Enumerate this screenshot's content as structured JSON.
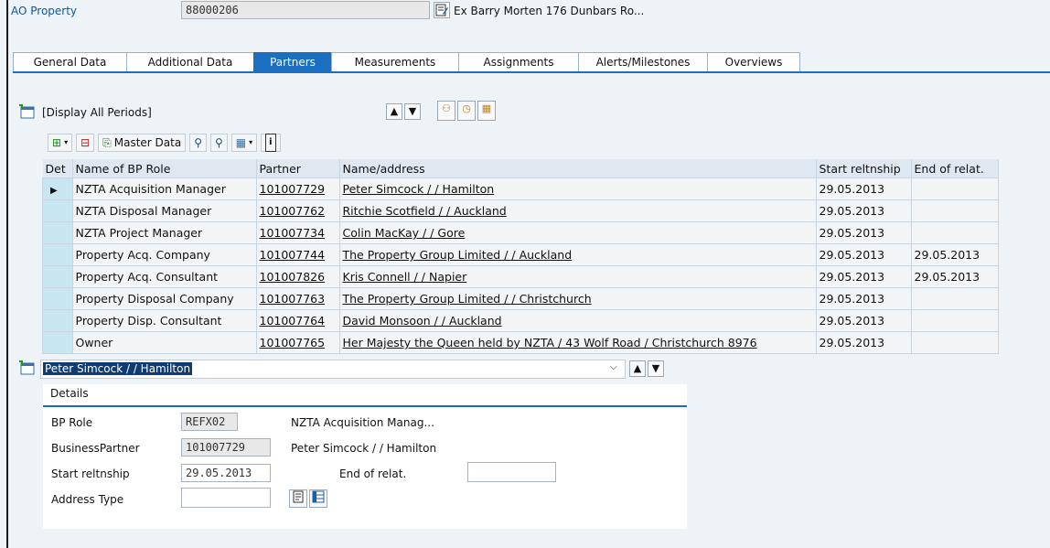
{
  "header": {
    "object_label": "AO Property",
    "object_id": "88000206",
    "object_desc": "Ex Barry Morten 176 Dunbars Ro..."
  },
  "tabs": [
    {
      "label": "General Data",
      "active": false
    },
    {
      "label": "Additional Data",
      "active": false
    },
    {
      "label": "Partners",
      "active": true
    },
    {
      "label": "Measurements",
      "active": false
    },
    {
      "label": "Assignments",
      "active": false
    },
    {
      "label": "Alerts/Milestones",
      "active": false
    },
    {
      "label": "Overviews",
      "active": false
    }
  ],
  "period_select": {
    "value": "[Display All Periods]"
  },
  "toolbar": {
    "master_data": "Master Data"
  },
  "table": {
    "columns": [
      "Det",
      "Name of BP Role",
      "Partner",
      "Name/address",
      "Start reltnship",
      "End of relat."
    ],
    "rows": [
      {
        "role": "NZTA Acquisition Manager",
        "partner": "101007729",
        "name": "Peter Simcock / / Hamilton",
        "start": "29.05.2013",
        "end": "",
        "selected": true
      },
      {
        "role": "NZTA Disposal Manager",
        "partner": "101007762",
        "name": "Ritchie Scotfield / / Auckland",
        "start": "29.05.2013",
        "end": ""
      },
      {
        "role": "NZTA Project Manager",
        "partner": "101007734",
        "name": "Colin MacKay / / Gore",
        "start": "29.05.2013",
        "end": ""
      },
      {
        "role": "Property Acq. Company",
        "partner": "101007744",
        "name": "The Property Group Limited / / Auckland",
        "start": "29.05.2013",
        "end": "29.05.2013"
      },
      {
        "role": "Property Acq. Consultant",
        "partner": "101007826",
        "name": "Kris Connell / / Napier",
        "start": "29.05.2013",
        "end": "29.05.2013"
      },
      {
        "role": "Property Disposal Company",
        "partner": "101007763",
        "name": "The Property Group Limited / / Christchurch",
        "start": "29.05.2013",
        "end": ""
      },
      {
        "role": "Property Disp. Consultant",
        "partner": "101007764",
        "name": "David Monsoon / / Auckland",
        "start": "29.05.2013",
        "end": ""
      },
      {
        "role": "Owner",
        "partner": "101007765",
        "name": "Her Majesty the Queen held by NZTA / 43 Wolf Road / Christchurch 8976",
        "start": "29.05.2013",
        "end": ""
      }
    ]
  },
  "partner_select": {
    "value": "Peter Simcock / / Hamilton"
  },
  "details": {
    "title": "Details",
    "bp_role_label": "BP Role",
    "bp_role_value": "REFX02",
    "bp_role_desc": "NZTA Acquisition Manag...",
    "bp_label": "BusinessPartner",
    "bp_value": "101007729",
    "bp_desc": "Peter Simcock / / Hamilton",
    "start_label": "Start reltnship",
    "start_value": "29.05.2013",
    "end_label": "End of relat.",
    "end_value": "",
    "addr_type_label": "Address Type",
    "addr_type_value": ""
  }
}
